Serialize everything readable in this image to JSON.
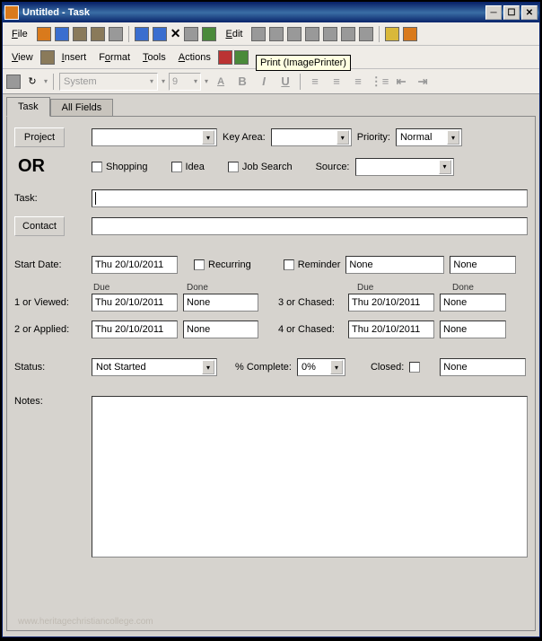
{
  "title": "Untitled - Task",
  "menu": {
    "file": "File",
    "view": "View",
    "insert": "Insert",
    "format": "Format",
    "tools": "Tools",
    "actions": "Actions",
    "edit": "Edit"
  },
  "tooltip": "Print (ImagePrinter)",
  "font": {
    "family": "System",
    "size": "9"
  },
  "fmtbtns": {
    "bold": "B",
    "italic": "I",
    "underline": "U"
  },
  "tabs": {
    "task": "Task",
    "allfields": "All Fields"
  },
  "buttons": {
    "project": "Project",
    "contact": "Contact"
  },
  "labels": {
    "keyarea": "Key Area:",
    "priority": "Priority:",
    "or": "OR",
    "shopping": "Shopping",
    "idea": "Idea",
    "jobsearch": "Job Search",
    "source": "Source:",
    "task": "Task:",
    "startdate": "Start Date:",
    "recurring": "Recurring",
    "reminder": "Reminder",
    "due": "Due",
    "done": "Done",
    "1viewed": "1 or Viewed:",
    "3chased": "3 or Chased:",
    "2applied": "2 or Applied:",
    "4chased": "4 or Chased:",
    "status": "Status:",
    "complete": "% Complete:",
    "closed": "Closed:",
    "notes": "Notes:"
  },
  "values": {
    "priority": "Normal",
    "date": "Thu 20/10/2011",
    "none": "None",
    "status": "Not Started",
    "complete": "0%"
  },
  "watermark": "www.heritagechristiancollege.com"
}
